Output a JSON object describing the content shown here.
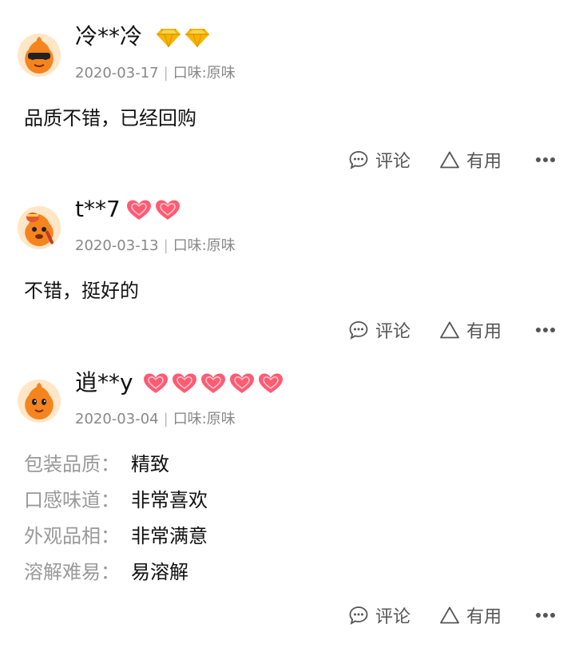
{
  "reviews": [
    {
      "username": "冷**冷",
      "date": "2020-03-17",
      "flavor": "口味:原味",
      "badge_type": "gold-diamond",
      "badge_count": 2,
      "content": "品质不错，已经回购",
      "actions": {
        "comment": "评论",
        "useful": "有用"
      }
    },
    {
      "username": "t**7",
      "date": "2020-03-13",
      "flavor": "口味:原味",
      "badge_type": "red-heart",
      "badge_count": 2,
      "content": "不错，挺好的",
      "actions": {
        "comment": "评论",
        "useful": "有用"
      }
    },
    {
      "username": "逍**y",
      "date": "2020-03-04",
      "flavor": "口味:原味",
      "badge_type": "red-heart",
      "badge_count": 5,
      "attributes": [
        {
          "key": "包装品质：",
          "value": "精致"
        },
        {
          "key": "口感味道：",
          "value": "非常喜欢"
        },
        {
          "key": "外观品相：",
          "value": "非常满意"
        },
        {
          "key": "溶解难易：",
          "value": "易溶解"
        }
      ],
      "actions": {
        "comment": "评论",
        "useful": "有用"
      }
    }
  ],
  "icons": {
    "comment": "comment-bubble-icon",
    "useful": "triangle-thumb-icon",
    "more": "more-dots-icon"
  },
  "colors": {
    "avatar_orange": "#f5841f",
    "gold_badge": "#f7b500",
    "heart_badge": "#ff5b73"
  }
}
